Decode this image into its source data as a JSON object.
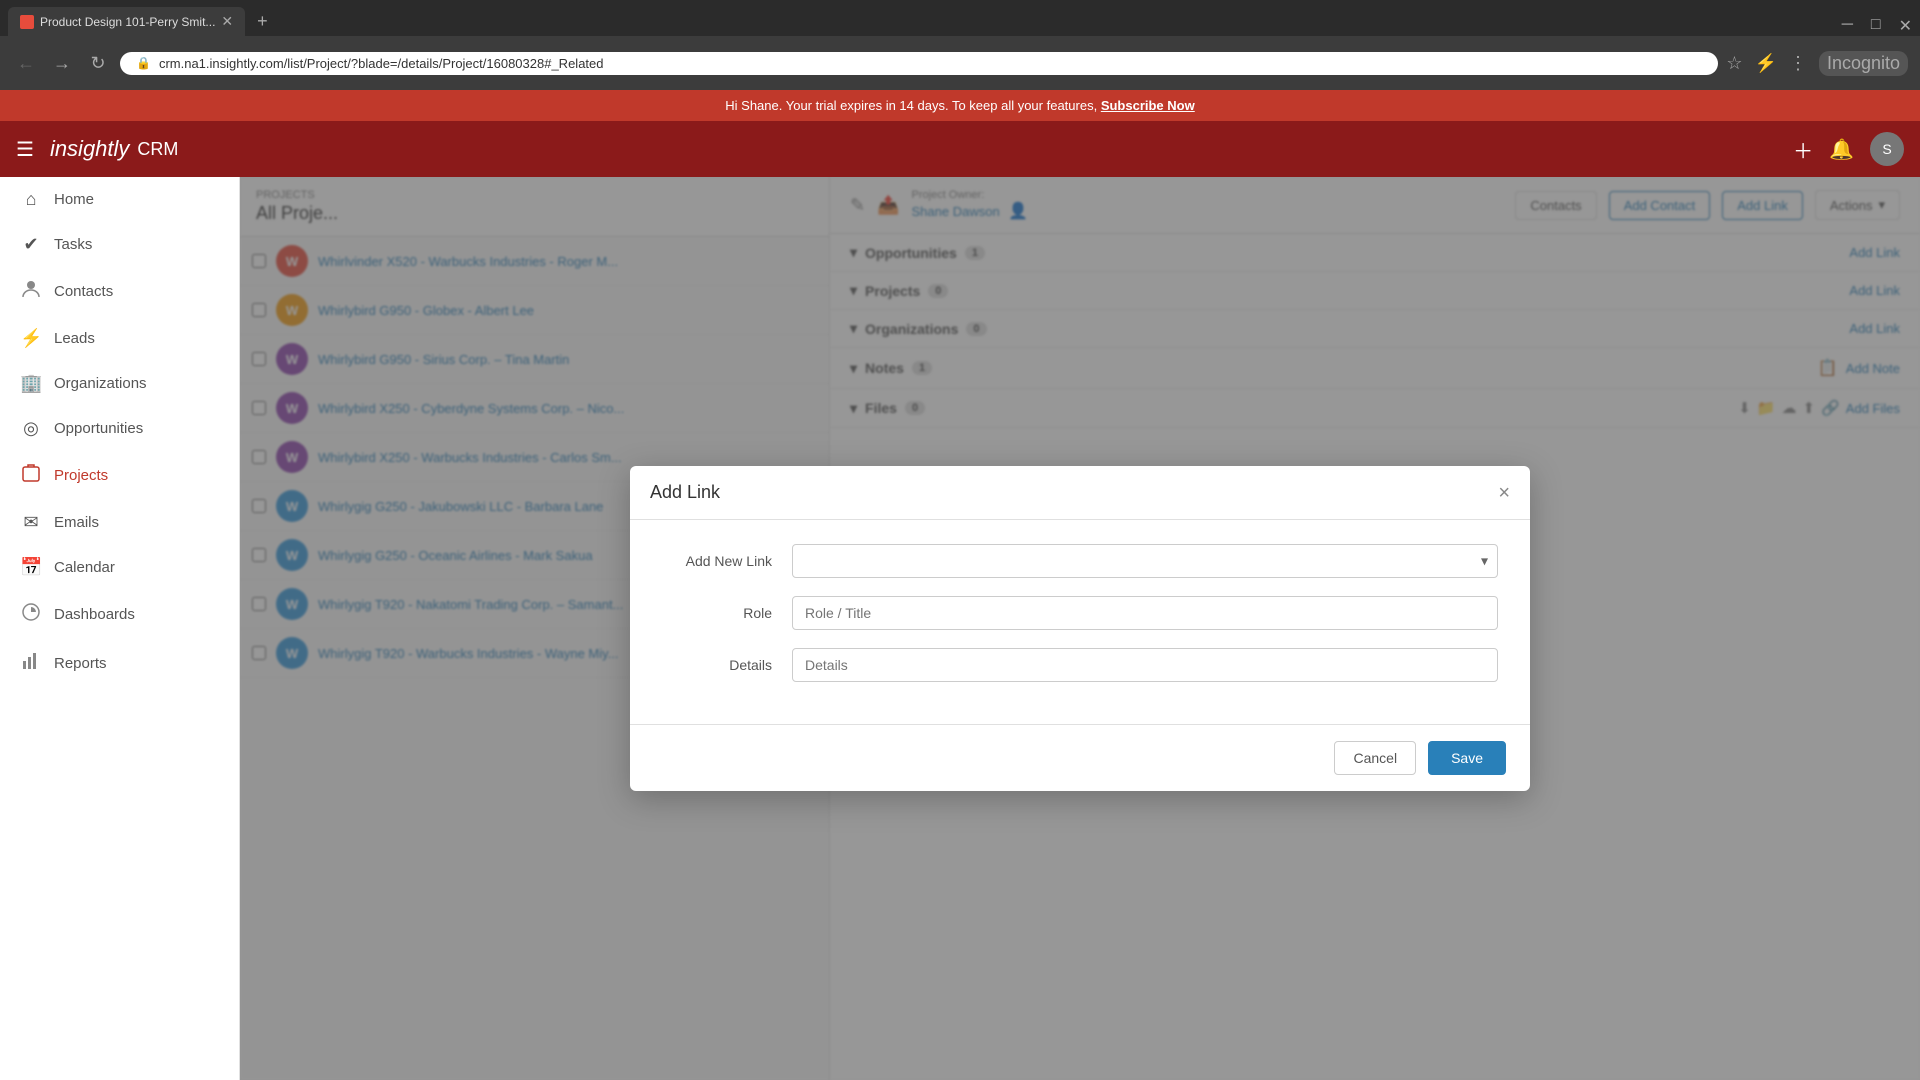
{
  "browser": {
    "tab_title": "Product Design 101-Perry Smit...",
    "url": "crm.na1.insightly.com/list/Project/?blade=/details/Project/16080328#_Related",
    "incognito_label": "Incognito"
  },
  "trial_banner": {
    "message": "Hi Shane. Your trial expires in 14 days. To keep all your features,",
    "cta": "Subscribe Now"
  },
  "app": {
    "logo": "insightly",
    "product": "CRM"
  },
  "sidebar": {
    "items": [
      {
        "label": "Home",
        "icon": "⌂"
      },
      {
        "label": "Tasks",
        "icon": "✓"
      },
      {
        "label": "Contacts",
        "icon": "👤"
      },
      {
        "label": "Leads",
        "icon": "⚡"
      },
      {
        "label": "Organizations",
        "icon": "🏢"
      },
      {
        "label": "Opportunities",
        "icon": "◎"
      },
      {
        "label": "Projects",
        "icon": "📋"
      },
      {
        "label": "Emails",
        "icon": "✉"
      },
      {
        "label": "Calendar",
        "icon": "📅"
      },
      {
        "label": "Dashboards",
        "icon": "📊"
      },
      {
        "label": "Reports",
        "icon": "📈"
      }
    ]
  },
  "project_list": {
    "breadcrumb": "PROJECTS",
    "title": "All Proje...",
    "rows": [
      {
        "avatar_color": "#e74c3c",
        "avatar_letter": "W",
        "link": "Whirlvinder X520 - Warbucks Industries - Roger M..."
      },
      {
        "avatar_color": "#f39c12",
        "avatar_letter": "W",
        "link": "Whirlybird G950 - Globex - Albert Lee"
      },
      {
        "avatar_color": "#8e44ad",
        "avatar_letter": "W",
        "link": "Whirlybird G950 - Sirius Corp. – Tina Martin"
      },
      {
        "avatar_color": "#8e44ad",
        "avatar_letter": "W",
        "link": "Whirlybird X250 - Cyberdyne Systems Corp. – Nico..."
      },
      {
        "avatar_color": "#8e44ad",
        "avatar_letter": "W",
        "link": "Whirlybird X250 - Warbucks Industries - Carlos Sm..."
      },
      {
        "avatar_color": "#3498db",
        "avatar_letter": "W",
        "link": "Whirlygig G250 - Jakubowski LLC - Barbara Lane"
      },
      {
        "avatar_color": "#3498db",
        "avatar_letter": "W",
        "link": "Whirlygig G250 - Oceanic Airlines - Mark Sakua"
      },
      {
        "avatar_color": "#3498db",
        "avatar_letter": "W",
        "link": "Whirlygig T920 - Nakatomi Trading Corp. – Samant..."
      },
      {
        "avatar_color": "#3498db",
        "avatar_letter": "W",
        "link": "Whirlygig T920 - Warbucks Industries - Wayne Miy..."
      }
    ]
  },
  "detail_panel": {
    "project_owner_label": "Project Owner:",
    "project_owner_name": "Shane Dawson",
    "tabs": {
      "contacts": "Contacts",
      "add_contact": "Add Contact",
      "add_link": "Add Link"
    },
    "actions_label": "Actions",
    "sections": [
      {
        "title": "Opportunities",
        "count": "1",
        "action": "Add Link"
      },
      {
        "title": "Projects",
        "count": "0",
        "action": "Add Link"
      },
      {
        "title": "Organizations",
        "count": "0",
        "action": "Add Link"
      },
      {
        "title": "Notes",
        "count": "1",
        "action": "Add Note"
      },
      {
        "title": "Files",
        "count": "0",
        "action": "Add Files"
      }
    ]
  },
  "modal": {
    "title": "Add Link",
    "close_label": "×",
    "fields": {
      "add_new_link_label": "Add New Link",
      "add_new_link_placeholder": "",
      "role_label": "Role",
      "role_placeholder": "Role / Title",
      "details_label": "Details",
      "details_placeholder": "Details"
    },
    "buttons": {
      "cancel": "Cancel",
      "save": "Save"
    }
  }
}
